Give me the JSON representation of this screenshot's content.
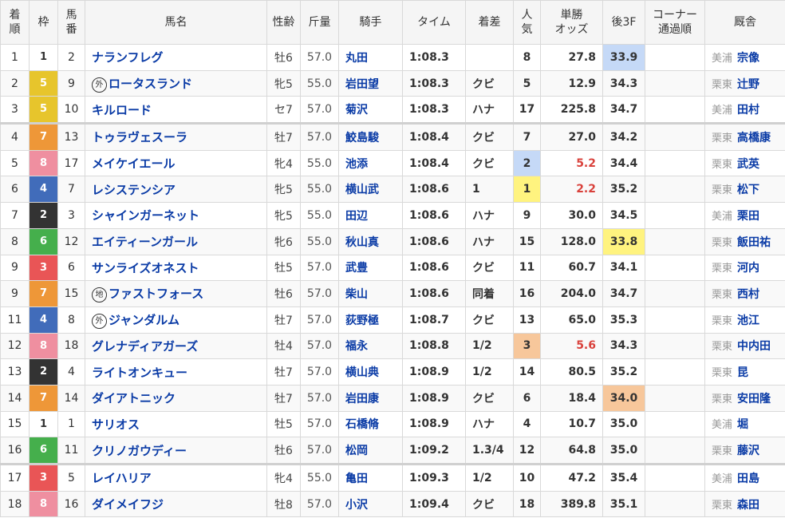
{
  "headers": {
    "rank": [
      "着",
      "順"
    ],
    "waku": "枠",
    "umaban": [
      "馬",
      "番"
    ],
    "name": "馬名",
    "sexage": "性齢",
    "weight": "斤量",
    "jockey": "騎手",
    "time": "タイム",
    "margin": "着差",
    "pop": [
      "人",
      "気"
    ],
    "odds": [
      "単勝",
      "オッズ"
    ],
    "last3f": "後3F",
    "corner": [
      "コーナー",
      "通過順"
    ],
    "stable": "厩舎"
  },
  "colors": {
    "horse_link": "#0a3ba6",
    "odds_highlight": "#d9413b",
    "rank1_highlight": "#c5d9f7",
    "rank2_highlight": "#fff37f",
    "rank3_highlight": "#f7c79b"
  },
  "rows": [
    {
      "rank": "1",
      "waku": "1",
      "umaban": "2",
      "badge": "",
      "name": "ナランフレグ",
      "sexage": "牡6",
      "weight": "57.0",
      "jockey": "丸田",
      "time": "1:08.3",
      "margin": "",
      "pop": "8",
      "odds": "27.8",
      "last3f": "33.9",
      "stable_region": "美浦",
      "stable": "宗像"
    },
    {
      "rank": "2",
      "waku": "5",
      "umaban": "9",
      "badge": "外",
      "name": "ロータスランド",
      "sexage": "牝5",
      "weight": "55.0",
      "jockey": "岩田望",
      "time": "1:08.3",
      "margin": "クビ",
      "pop": "5",
      "odds": "12.9",
      "last3f": "34.3",
      "stable_region": "栗東",
      "stable": "辻野"
    },
    {
      "rank": "3",
      "waku": "5",
      "umaban": "10",
      "badge": "",
      "name": "キルロード",
      "sexage": "セ7",
      "weight": "57.0",
      "jockey": "菊沢",
      "time": "1:08.3",
      "margin": "ハナ",
      "pop": "17",
      "odds": "225.8",
      "last3f": "34.7",
      "stable_region": "美浦",
      "stable": "田村"
    },
    {
      "rank": "4",
      "waku": "7",
      "umaban": "13",
      "badge": "",
      "name": "トゥラヴェスーラ",
      "sexage": "牡7",
      "weight": "57.0",
      "jockey": "鮫島駿",
      "time": "1:08.4",
      "margin": "クビ",
      "pop": "7",
      "odds": "27.0",
      "last3f": "34.2",
      "stable_region": "栗東",
      "stable": "高橋康"
    },
    {
      "rank": "5",
      "waku": "8",
      "umaban": "17",
      "badge": "",
      "name": "メイケイエール",
      "sexage": "牝4",
      "weight": "55.0",
      "jockey": "池添",
      "time": "1:08.4",
      "margin": "クビ",
      "pop": "2",
      "odds": "5.2",
      "last3f": "34.4",
      "stable_region": "栗東",
      "stable": "武英"
    },
    {
      "rank": "6",
      "waku": "4",
      "umaban": "7",
      "badge": "",
      "name": "レシステンシア",
      "sexage": "牝5",
      "weight": "55.0",
      "jockey": "横山武",
      "time": "1:08.6",
      "margin": "1",
      "pop": "1",
      "odds": "2.2",
      "last3f": "35.2",
      "stable_region": "栗東",
      "stable": "松下"
    },
    {
      "rank": "7",
      "waku": "2",
      "umaban": "3",
      "badge": "",
      "name": "シャインガーネット",
      "sexage": "牝5",
      "weight": "55.0",
      "jockey": "田辺",
      "time": "1:08.6",
      "margin": "ハナ",
      "pop": "9",
      "odds": "30.0",
      "last3f": "34.5",
      "stable_region": "美浦",
      "stable": "栗田"
    },
    {
      "rank": "8",
      "waku": "6",
      "umaban": "12",
      "badge": "",
      "name": "エイティーンガール",
      "sexage": "牝6",
      "weight": "55.0",
      "jockey": "秋山真",
      "time": "1:08.6",
      "margin": "ハナ",
      "pop": "15",
      "odds": "128.0",
      "last3f": "33.8",
      "stable_region": "栗東",
      "stable": "飯田祐"
    },
    {
      "rank": "9",
      "waku": "3",
      "umaban": "6",
      "badge": "",
      "name": "サンライズオネスト",
      "sexage": "牡5",
      "weight": "57.0",
      "jockey": "武豊",
      "time": "1:08.6",
      "margin": "クビ",
      "pop": "11",
      "odds": "60.7",
      "last3f": "34.1",
      "stable_region": "栗東",
      "stable": "河内"
    },
    {
      "rank": "9",
      "waku": "7",
      "umaban": "15",
      "badge": "地",
      "name": "ファストフォース",
      "sexage": "牡6",
      "weight": "57.0",
      "jockey": "柴山",
      "time": "1:08.6",
      "margin": "同着",
      "pop": "16",
      "odds": "204.0",
      "last3f": "34.7",
      "stable_region": "栗東",
      "stable": "西村"
    },
    {
      "rank": "11",
      "waku": "4",
      "umaban": "8",
      "badge": "外",
      "name": "ジャンダルム",
      "sexage": "牡7",
      "weight": "57.0",
      "jockey": "荻野極",
      "time": "1:08.7",
      "margin": "クビ",
      "pop": "13",
      "odds": "65.0",
      "last3f": "35.3",
      "stable_region": "栗東",
      "stable": "池江"
    },
    {
      "rank": "12",
      "waku": "8",
      "umaban": "18",
      "badge": "",
      "name": "グレナディアガーズ",
      "sexage": "牡4",
      "weight": "57.0",
      "jockey": "福永",
      "time": "1:08.8",
      "margin": "1/2",
      "pop": "3",
      "odds": "5.6",
      "last3f": "34.3",
      "stable_region": "栗東",
      "stable": "中内田"
    },
    {
      "rank": "13",
      "waku": "2",
      "umaban": "4",
      "badge": "",
      "name": "ライトオンキュー",
      "sexage": "牡7",
      "weight": "57.0",
      "jockey": "横山典",
      "time": "1:08.9",
      "margin": "1/2",
      "pop": "14",
      "odds": "80.5",
      "last3f": "35.2",
      "stable_region": "栗東",
      "stable": "昆"
    },
    {
      "rank": "14",
      "waku": "7",
      "umaban": "14",
      "badge": "",
      "name": "ダイアトニック",
      "sexage": "牡7",
      "weight": "57.0",
      "jockey": "岩田康",
      "time": "1:08.9",
      "margin": "クビ",
      "pop": "6",
      "odds": "18.4",
      "last3f": "34.0",
      "stable_region": "栗東",
      "stable": "安田隆"
    },
    {
      "rank": "15",
      "waku": "1",
      "umaban": "1",
      "badge": "",
      "name": "サリオス",
      "sexage": "牡5",
      "weight": "57.0",
      "jockey": "石橋脩",
      "time": "1:08.9",
      "margin": "ハナ",
      "pop": "4",
      "odds": "10.7",
      "last3f": "35.0",
      "stable_region": "美浦",
      "stable": "堀"
    },
    {
      "rank": "16",
      "waku": "6",
      "umaban": "11",
      "badge": "",
      "name": "クリノガウディー",
      "sexage": "牡6",
      "weight": "57.0",
      "jockey": "松岡",
      "time": "1:09.2",
      "margin": "1.3/4",
      "pop": "12",
      "odds": "64.8",
      "last3f": "35.0",
      "stable_region": "栗東",
      "stable": "藤沢"
    },
    {
      "rank": "17",
      "waku": "3",
      "umaban": "5",
      "badge": "",
      "name": "レイハリア",
      "sexage": "牝4",
      "weight": "55.0",
      "jockey": "亀田",
      "time": "1:09.3",
      "margin": "1/2",
      "pop": "10",
      "odds": "47.2",
      "last3f": "35.4",
      "stable_region": "美浦",
      "stable": "田島"
    },
    {
      "rank": "18",
      "waku": "8",
      "umaban": "16",
      "badge": "",
      "name": "ダイメイフジ",
      "sexage": "牡8",
      "weight": "57.0",
      "jockey": "小沢",
      "time": "1:09.4",
      "margin": "クビ",
      "pop": "18",
      "odds": "389.8",
      "last3f": "35.1",
      "stable_region": "栗東",
      "stable": "森田"
    }
  ]
}
